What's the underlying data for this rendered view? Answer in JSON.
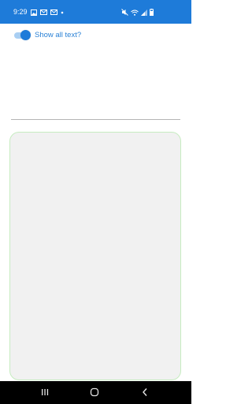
{
  "status_bar": {
    "time": "9:29",
    "background": "#1e7bd9",
    "left_icons": [
      "image-icon",
      "gmail-icon",
      "gmail-icon",
      "dot-icon"
    ],
    "right_icons": [
      "mute-icon",
      "wifi-icon",
      "signal-icon",
      "battery-icon"
    ]
  },
  "toggle": {
    "label": "Show all text?",
    "checked": true,
    "accent_color": "#1e7bd9"
  },
  "panel": {
    "background": "#f1f1f1",
    "border_color": "#c6ecc0"
  },
  "nav_bar": {
    "buttons": [
      "recents-icon",
      "home-icon",
      "back-icon"
    ]
  }
}
